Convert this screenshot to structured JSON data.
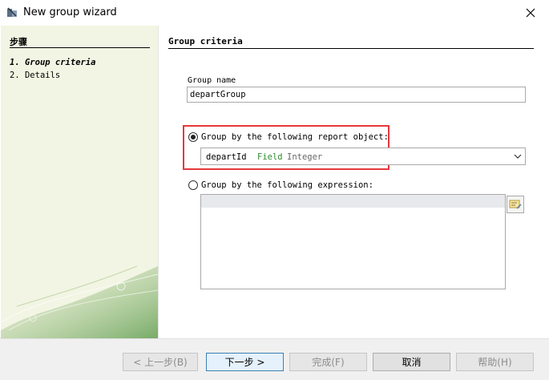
{
  "window": {
    "title": "New group wizard",
    "close_icon": "close-icon",
    "app_icon": "wizard-icon"
  },
  "steps": {
    "title": "步骤",
    "items": [
      {
        "number": "1.",
        "label": "Group criteria",
        "active": true
      },
      {
        "number": "2.",
        "label": "Details",
        "active": false
      }
    ]
  },
  "page": {
    "title": "Group criteria",
    "group_name_label": "Group name",
    "group_name_value": "departGroup",
    "option_report_object_label": "Group by the following report object:",
    "option_report_object_selected": true,
    "report_object": {
      "name": "departId",
      "kind": "Field",
      "data_type": "Integer"
    },
    "option_expression_label": "Group by the following expression:",
    "option_expression_selected": false,
    "expression_value": "",
    "expression_builder_icon": "expression-builder-icon"
  },
  "buttons": {
    "back": "< 上一步(B)",
    "next": "下一步 >",
    "finish": "完成(F)",
    "cancel": "取消",
    "help": "帮助(H)"
  },
  "colors": {
    "highlight": "#e5383b",
    "field_kind": "#2e8b2e",
    "left_panel": "#f2f5e3"
  }
}
